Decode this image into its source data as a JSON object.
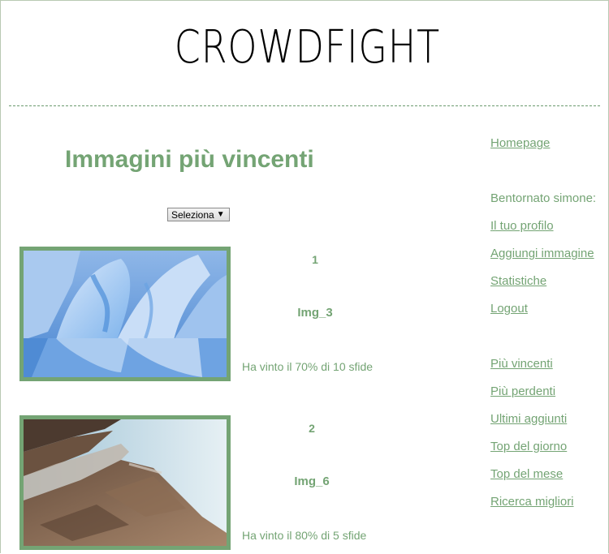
{
  "site": {
    "title": "CROWDFIGHT"
  },
  "main": {
    "page_title": "Immagini più vincenti",
    "select": {
      "value": "Seleziona"
    },
    "items": [
      {
        "rank": "1",
        "name": "Img_3",
        "stat": "Ha vinto il 70% di 10 sfide",
        "image": "glacier-ice-image"
      },
      {
        "rank": "2",
        "name": "Img_6",
        "stat": "Ha vinto il 80% di 5 sfide",
        "image": "rocky-coast-image"
      }
    ]
  },
  "sidebar": {
    "homepage": "Homepage",
    "welcome": "Bentornato simone:",
    "user_links": [
      "Il tuo profilo",
      "Aggiungi immagine",
      "Statistiche",
      "Logout"
    ],
    "ranking_links": [
      "Più vincenti",
      "Più perdenti",
      "Ultimi aggiunti",
      "Top del giorno",
      "Top del mese",
      "Ricerca migliori"
    ]
  },
  "colors": {
    "accent": "#74a474",
    "divider": "#6b9a6e"
  }
}
